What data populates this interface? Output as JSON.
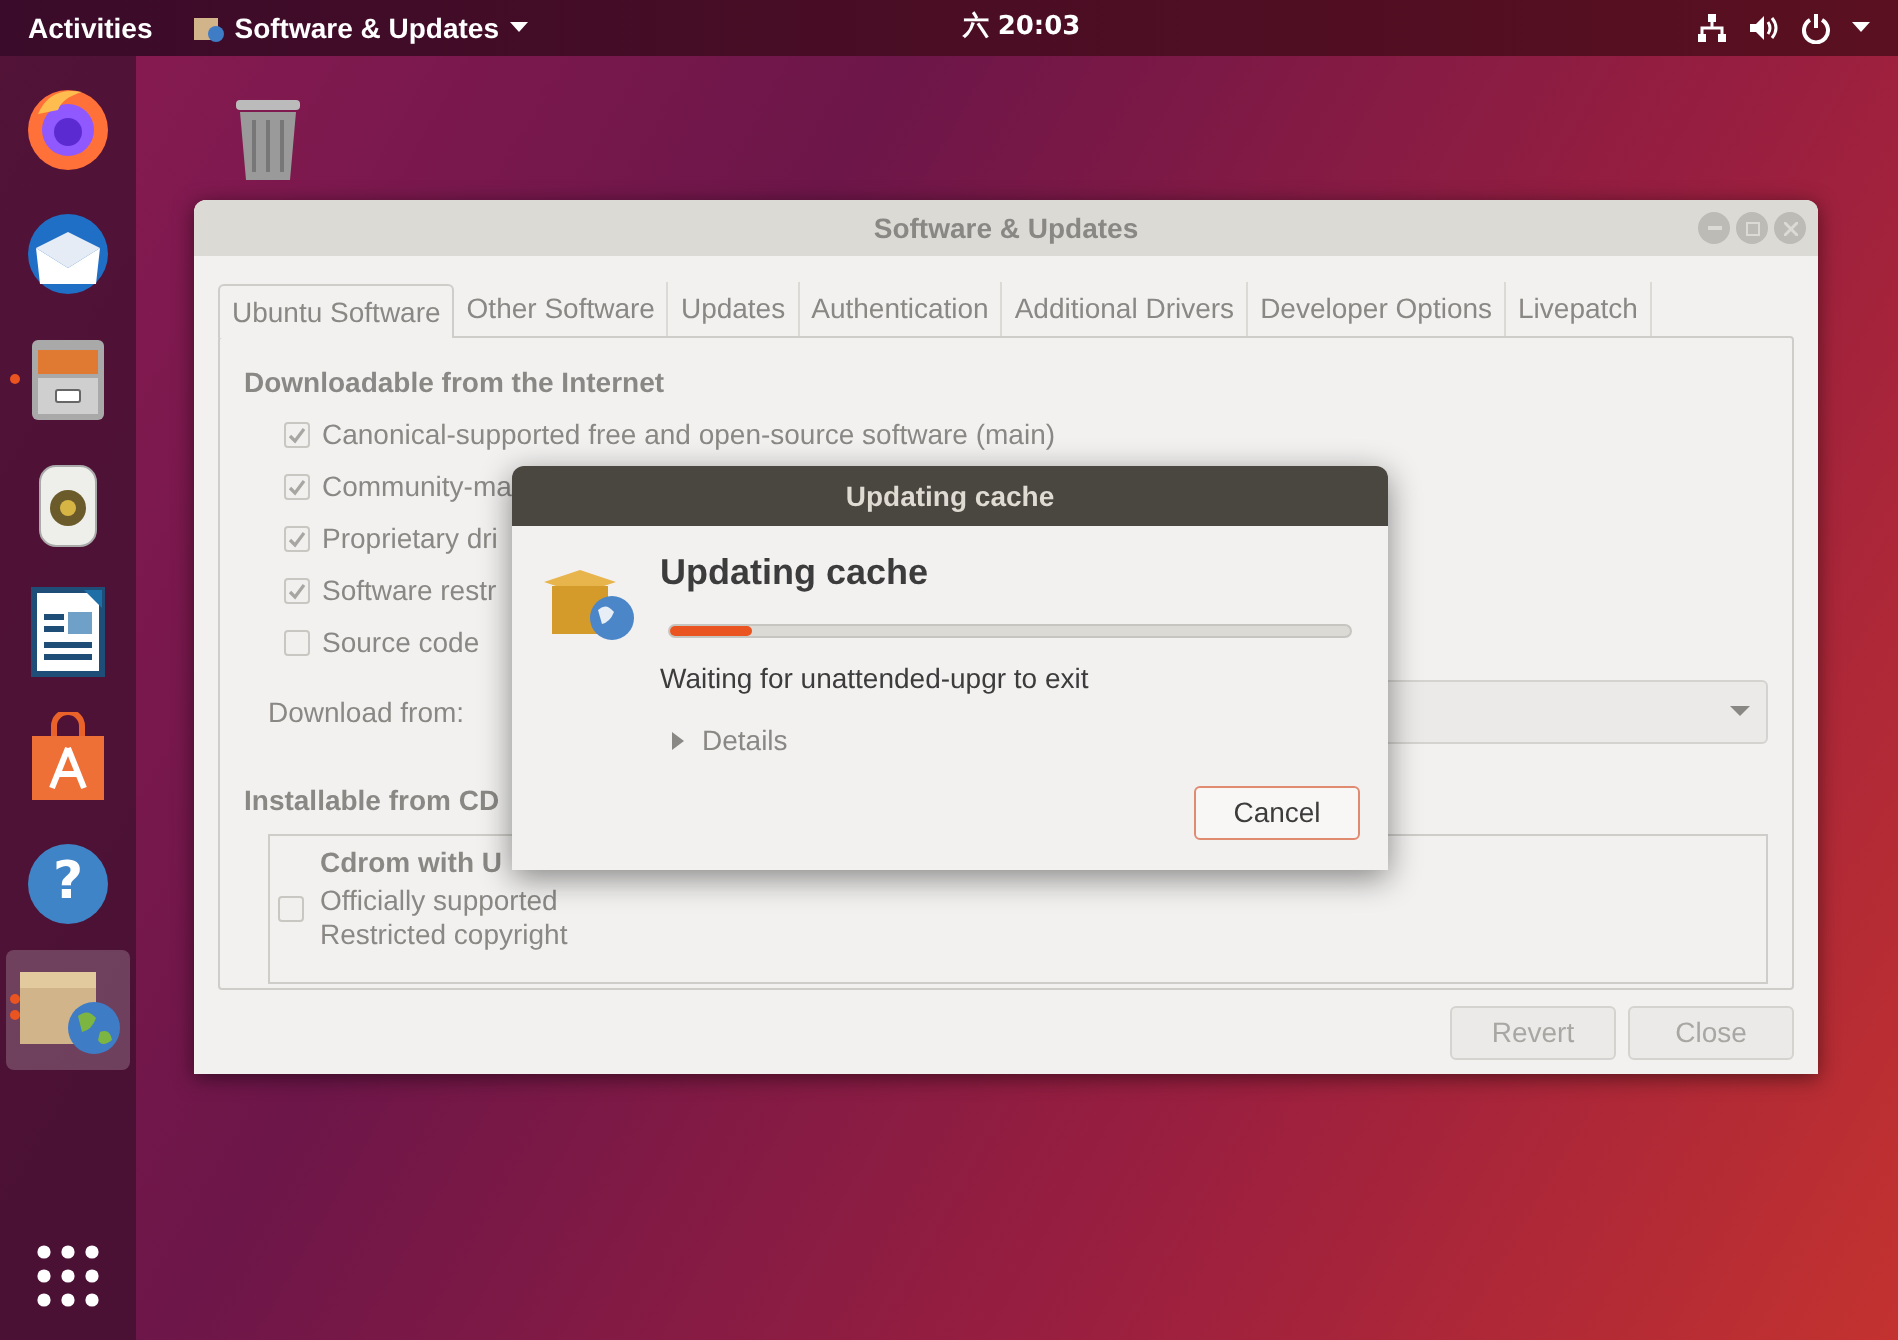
{
  "top_bar": {
    "activities": "Activities",
    "app_menu": "Software & Updates",
    "clock": "六 20:03"
  },
  "dock": {
    "items": [
      {
        "kind": "firefox",
        "running": false,
        "multiple_windows": false,
        "selected": false
      },
      {
        "kind": "thunderbird",
        "running": false,
        "multiple_windows": false,
        "selected": false
      },
      {
        "kind": "files",
        "running": true,
        "multiple_windows": false,
        "selected": false
      },
      {
        "kind": "rhythmbox",
        "running": false,
        "multiple_windows": false,
        "selected": false
      },
      {
        "kind": "writer",
        "running": false,
        "multiple_windows": false,
        "selected": false
      },
      {
        "kind": "software",
        "running": false,
        "multiple_windows": false,
        "selected": false
      },
      {
        "kind": "help",
        "glyph": "?",
        "running": false,
        "multiple_windows": false,
        "selected": false
      },
      {
        "kind": "updates",
        "running": true,
        "multiple_windows": true,
        "selected": true
      }
    ]
  },
  "window": {
    "title": "Software & Updates",
    "tabs": [
      {
        "label": "Ubuntu Software",
        "selected": true
      },
      {
        "label": "Other Software",
        "selected": false
      },
      {
        "label": "Updates",
        "selected": false
      },
      {
        "label": "Authentication",
        "selected": false
      },
      {
        "label": "Additional Drivers",
        "selected": false
      },
      {
        "label": "Developer Options",
        "selected": false
      },
      {
        "label": "Livepatch",
        "selected": false
      }
    ],
    "internet_section": {
      "heading": "Downloadable from the Internet",
      "options": [
        {
          "label": "Canonical-supported free and open-source software (main)",
          "checked": true,
          "disabled": true
        },
        {
          "label": "Community-ma",
          "checked": true,
          "disabled": true
        },
        {
          "label": "Proprietary dri",
          "checked": true,
          "disabled": true
        },
        {
          "label": "Software restr",
          "checked": true,
          "disabled": true
        },
        {
          "label": "Source code",
          "checked": false,
          "disabled": true
        }
      ],
      "download_from_label": "Download from:"
    },
    "cd_section": {
      "heading": "Installable from CD",
      "item": {
        "title": "Cdrom with U",
        "lines": [
          "Officially supported",
          "Restricted copyright"
        ],
        "checked": false,
        "disabled": true
      }
    },
    "buttons": [
      {
        "label": "Revert",
        "disabled": true
      },
      {
        "label": "Close",
        "disabled": true
      }
    ]
  },
  "dialog": {
    "title": "Updating cache",
    "heading": "Updating cache",
    "progress": {
      "level": 0.12
    },
    "status": "Waiting for unattended-upgr to exit",
    "details": {
      "label": "Details",
      "expanded": false
    },
    "cancel": "Cancel"
  }
}
